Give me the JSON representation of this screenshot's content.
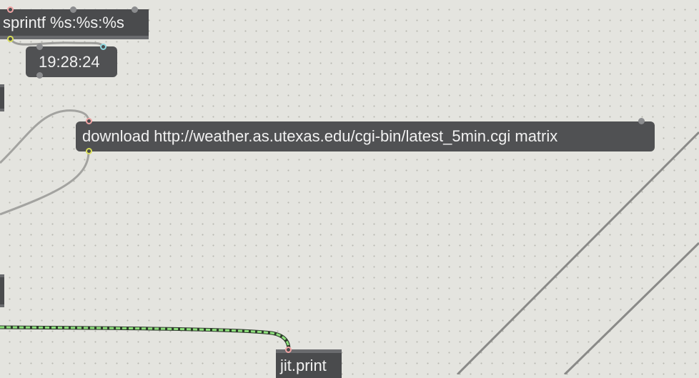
{
  "patcher": {
    "background": "#e4e4df",
    "objects": {
      "sprintf": {
        "text": "sprintf %s:%s:%s"
      },
      "time_message": {
        "text": "19:28:24"
      },
      "download_message": {
        "text": "download http://weather.as.utexas.edu/cgi-bin/latest_5min.cgi matrix"
      },
      "jit_print": {
        "text": "jit.print"
      }
    },
    "cord_colors": {
      "standard": "#a3a3a0",
      "dark": "#8a8a88",
      "matrix": "#8ee07c",
      "matrix_dash": "#2d3a2b"
    }
  }
}
